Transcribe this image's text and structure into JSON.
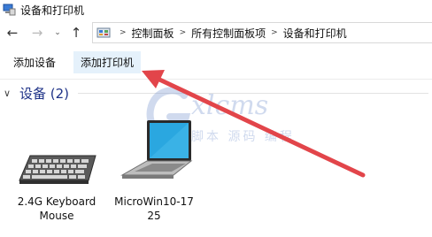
{
  "window": {
    "title": "设备和打印机"
  },
  "nav": {
    "back": "←",
    "forward": "→",
    "dropdown": "⌄",
    "up": "↑"
  },
  "breadcrumb": {
    "separator": ">",
    "items": [
      "控制面板",
      "所有控制面板项",
      "设备和打印机"
    ]
  },
  "commands": {
    "add_device": "添加设备",
    "add_printer": "添加打印机"
  },
  "section": {
    "chevron": "∨",
    "label": "设备 (2)"
  },
  "devices": [
    {
      "name": "2.4G Keyboard Mouse",
      "icon": "keyboard-icon"
    },
    {
      "name": "MicroWin10-1725",
      "icon": "laptop-icon"
    }
  ],
  "watermark": {
    "brand": "xlcms",
    "sub": "脚本 源码 编程"
  },
  "colors": {
    "arrow": "#e2454a",
    "accent": "#1e3287",
    "hover": "#e5f1fb"
  }
}
